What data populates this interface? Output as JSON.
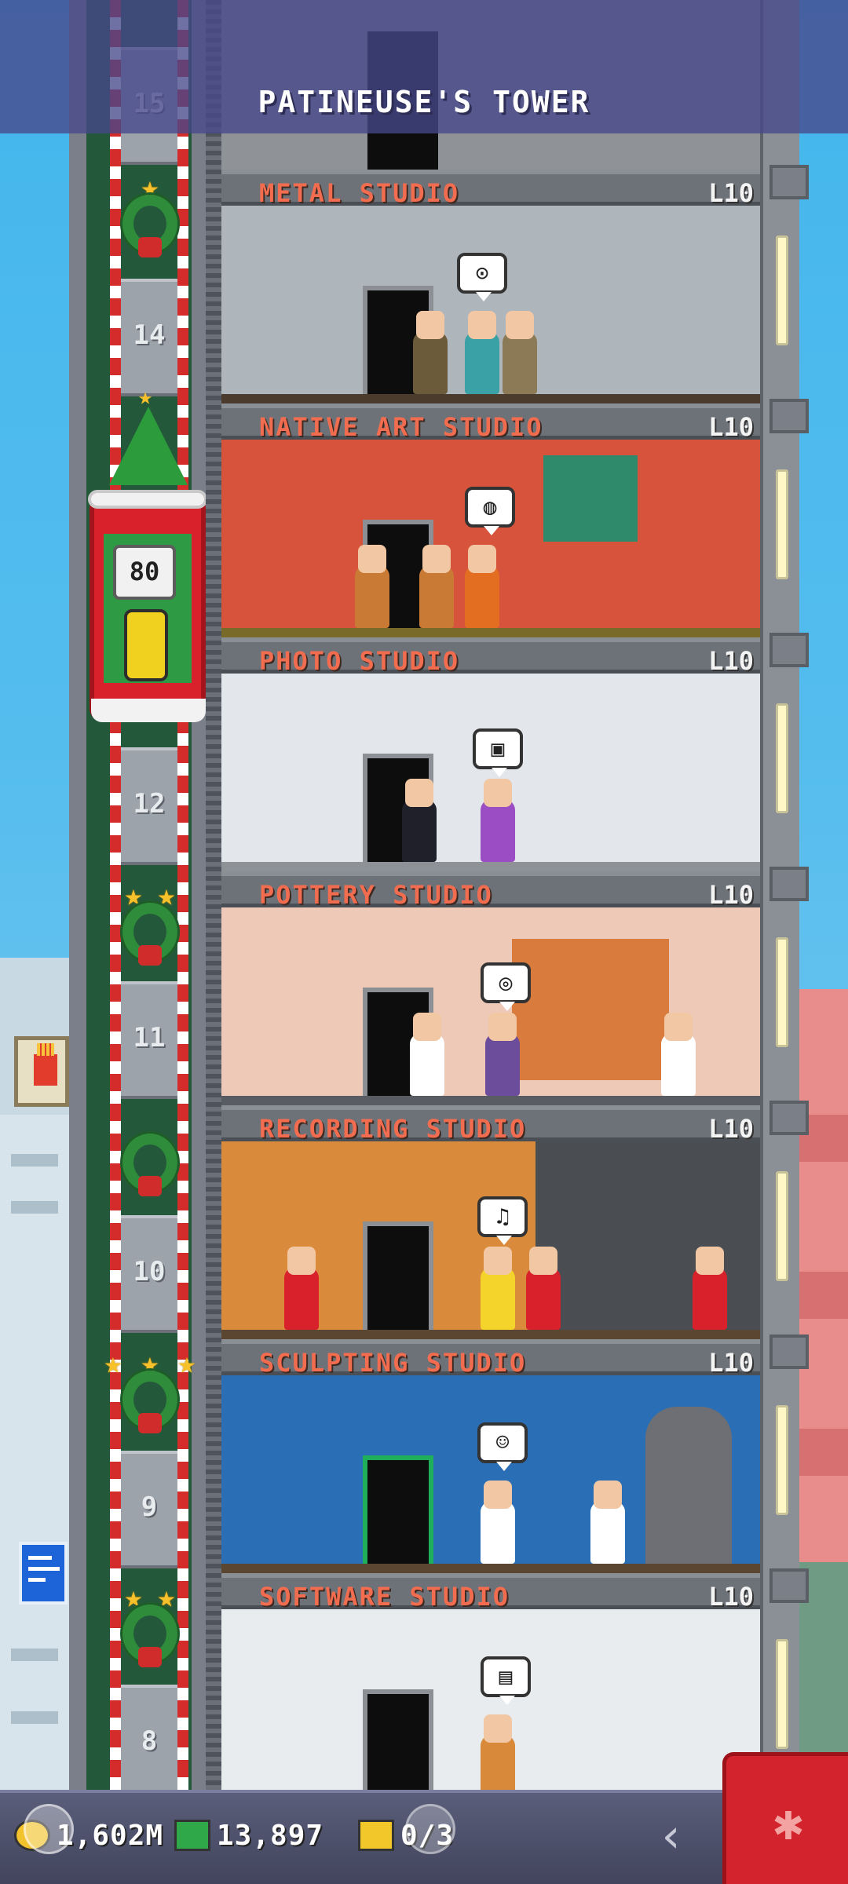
{
  "header": {
    "title": "PATINEUSE'S TOWER"
  },
  "elevator": {
    "current_floor_label": "80",
    "floor_numbers": [
      "15",
      "14",
      "12",
      "11",
      "10",
      "9",
      "8"
    ]
  },
  "floors": [
    {
      "name": "METAL STUDIO",
      "level": "L10",
      "bubble": "⊙",
      "wall": "#aeb5bb"
    },
    {
      "name": "NATIVE ART STUDIO",
      "level": "L10",
      "bubble": "◍",
      "wall": "#d7533c"
    },
    {
      "name": "PHOTO STUDIO",
      "level": "L10",
      "bubble": "▣",
      "wall": "#e3e6ea"
    },
    {
      "name": "POTTERY STUDIO",
      "level": "L10",
      "bubble": "◎",
      "wall": "#efc9b8"
    },
    {
      "name": "RECORDING STUDIO",
      "level": "L10",
      "bubble": "♫",
      "wall": "#d98a3a"
    },
    {
      "name": "SCULPTING STUDIO",
      "level": "L10",
      "bubble": "☺",
      "wall": "#2a6fb5"
    },
    {
      "name": "SOFTWARE STUDIO",
      "level": "L10",
      "bubble": "▤",
      "wall": "#e9ecee"
    }
  ],
  "stats": {
    "coins": "1,602M",
    "bux": "13,897",
    "tickets": "0/3"
  },
  "nav": {
    "back_glyph": "‹",
    "build_glyph": "✱"
  },
  "colors": {
    "label_text": "#f26c4f",
    "elevator": "#d8212b",
    "sky": "#43b6ec"
  }
}
